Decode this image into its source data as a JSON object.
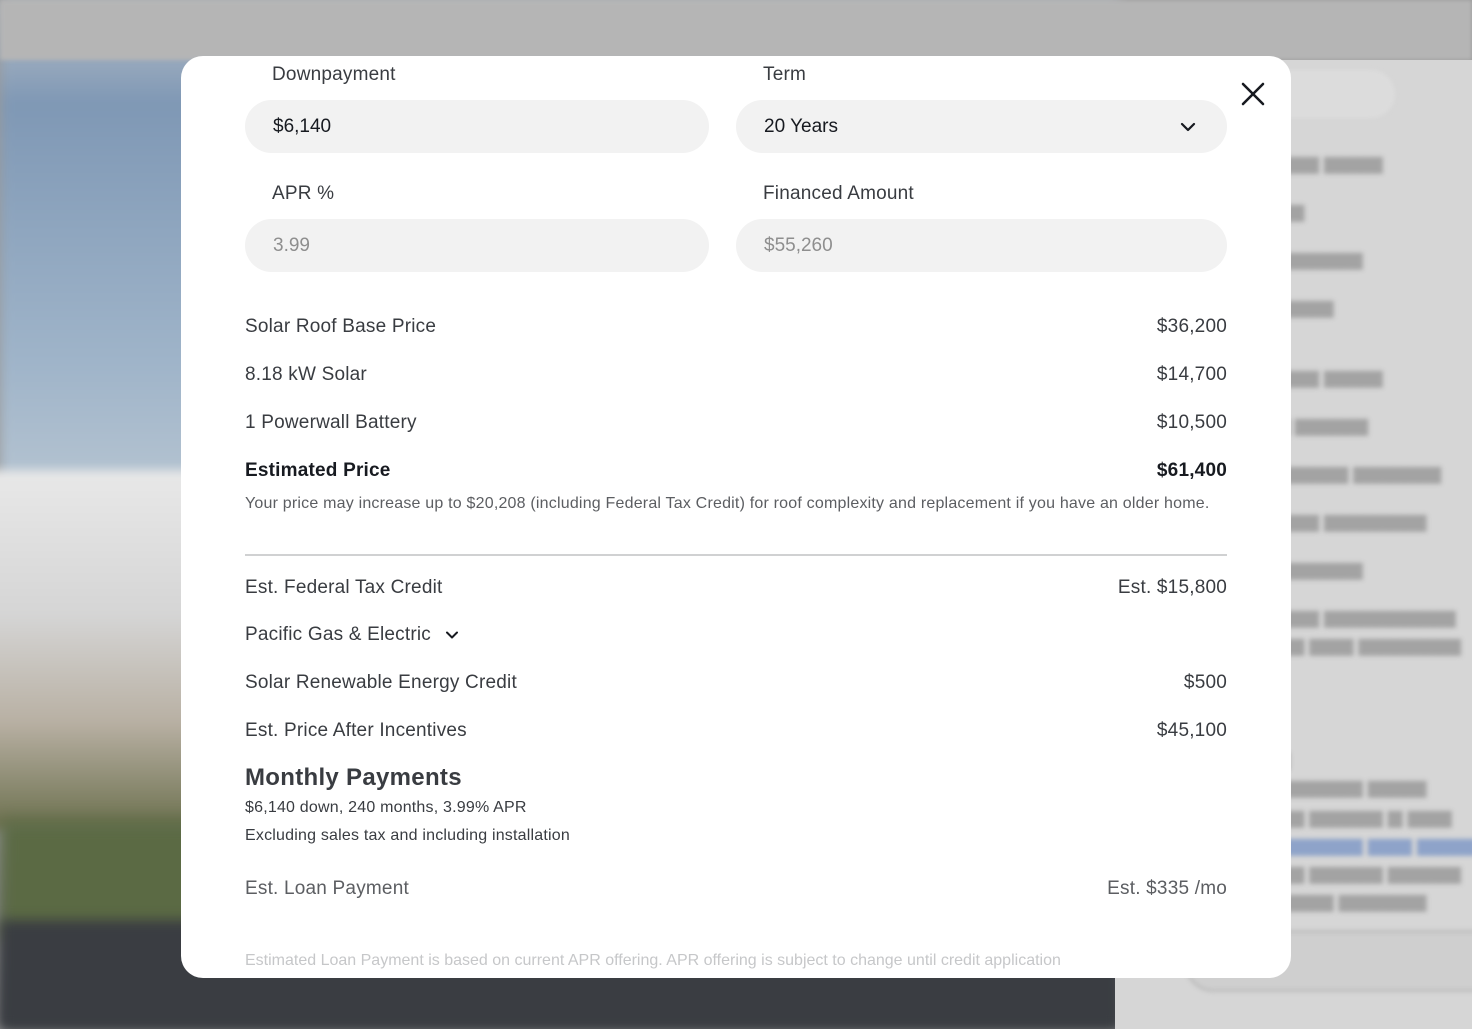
{
  "form": {
    "downpayment": {
      "label": "Downpayment",
      "value": "$6,140"
    },
    "term": {
      "label": "Term",
      "value": "20 Years",
      "icon": "chevron-down-icon"
    },
    "apr": {
      "label": "APR %",
      "placeholder": "3.99"
    },
    "financed": {
      "label": "Financed Amount",
      "placeholder": "$55,260"
    }
  },
  "pricing": {
    "items": [
      {
        "label": "Solar Roof Base Price",
        "value": "$36,200"
      },
      {
        "label": "8.18 kW Solar",
        "value": "$14,700"
      },
      {
        "label": "1 Powerwall Battery",
        "value": "$10,500"
      }
    ],
    "estimated": {
      "label": "Estimated Price",
      "value": "$61,400"
    },
    "disclaimer": "Your price may increase up to $20,208 (including Federal Tax Credit) for roof complexity and replacement if you have an older home."
  },
  "incentives": {
    "federal": {
      "label": "Est. Federal Tax Credit",
      "value": "Est. $15,800"
    },
    "utility": {
      "label": "Pacific Gas & Electric",
      "icon": "chevron-down-icon"
    },
    "srec": {
      "label": "Solar Renewable Energy Credit",
      "value": "$500"
    },
    "after": {
      "label": "Est. Price After Incentives",
      "value": "$45,100"
    }
  },
  "monthly": {
    "title": "Monthly Payments",
    "line1": "$6,140 down, 240 months, 3.99% APR",
    "line2": "Excluding sales tax and including installation",
    "loan_label": "Est. Loan Payment",
    "loan_value": "Est. $335 /mo",
    "footnote": "Estimated Loan Payment is based on current APR offering. APR offering is subject to change until credit application"
  },
  "close": {
    "icon": "close-icon"
  },
  "colors": {
    "modal_bg": "#ffffff",
    "field_bg": "#f2f2f2",
    "text": "#393c41",
    "muted": "#8e8e8e"
  }
}
